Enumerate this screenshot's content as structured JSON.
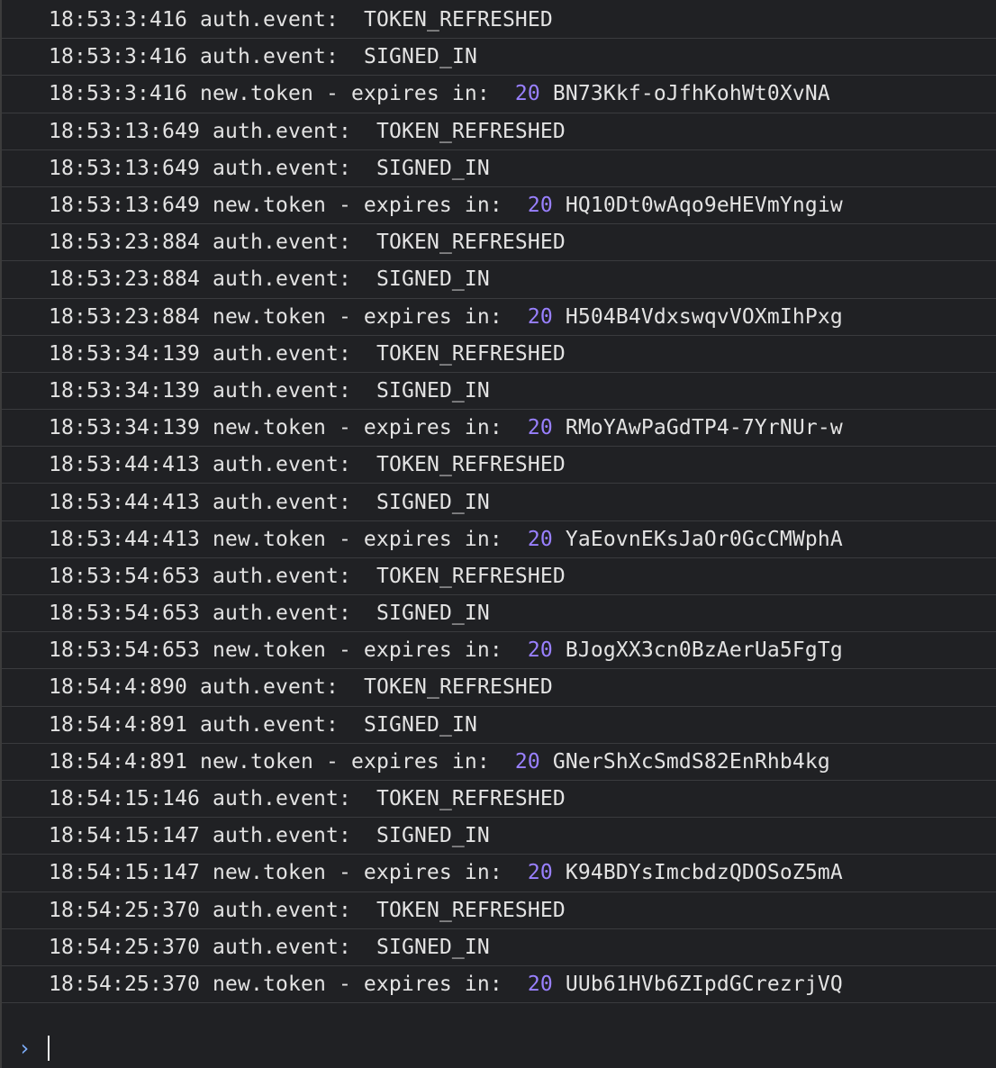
{
  "console": {
    "entries": [
      {
        "time": "18:53:3:416",
        "kind": "event",
        "label": "auth.event:",
        "value": "TOKEN_REFRESHED"
      },
      {
        "time": "18:53:3:416",
        "kind": "event",
        "label": "auth.event:",
        "value": "SIGNED_IN"
      },
      {
        "time": "18:53:3:416",
        "kind": "token",
        "label": "new.token - expires in:",
        "expires": "20",
        "value": "BN73Kkf-oJfhKohWt0XvNA"
      },
      {
        "time": "18:53:13:649",
        "kind": "event",
        "label": "auth.event:",
        "value": "TOKEN_REFRESHED"
      },
      {
        "time": "18:53:13:649",
        "kind": "event",
        "label": "auth.event:",
        "value": "SIGNED_IN"
      },
      {
        "time": "18:53:13:649",
        "kind": "token",
        "label": "new.token - expires in:",
        "expires": "20",
        "value": "HQ10Dt0wAqo9eHEVmYngiw"
      },
      {
        "time": "18:53:23:884",
        "kind": "event",
        "label": "auth.event:",
        "value": "TOKEN_REFRESHED"
      },
      {
        "time": "18:53:23:884",
        "kind": "event",
        "label": "auth.event:",
        "value": "SIGNED_IN"
      },
      {
        "time": "18:53:23:884",
        "kind": "token",
        "label": "new.token - expires in:",
        "expires": "20",
        "value": "H504B4VdxswqvVOXmIhPxg"
      },
      {
        "time": "18:53:34:139",
        "kind": "event",
        "label": "auth.event:",
        "value": "TOKEN_REFRESHED"
      },
      {
        "time": "18:53:34:139",
        "kind": "event",
        "label": "auth.event:",
        "value": "SIGNED_IN"
      },
      {
        "time": "18:53:34:139",
        "kind": "token",
        "label": "new.token - expires in:",
        "expires": "20",
        "value": "RMoYAwPaGdTP4-7YrNUr-w"
      },
      {
        "time": "18:53:44:413",
        "kind": "event",
        "label": "auth.event:",
        "value": "TOKEN_REFRESHED"
      },
      {
        "time": "18:53:44:413",
        "kind": "event",
        "label": "auth.event:",
        "value": "SIGNED_IN"
      },
      {
        "time": "18:53:44:413",
        "kind": "token",
        "label": "new.token - expires in:",
        "expires": "20",
        "value": "YaEovnEKsJaOr0GcCMWphA"
      },
      {
        "time": "18:53:54:653",
        "kind": "event",
        "label": "auth.event:",
        "value": "TOKEN_REFRESHED"
      },
      {
        "time": "18:53:54:653",
        "kind": "event",
        "label": "auth.event:",
        "value": "SIGNED_IN"
      },
      {
        "time": "18:53:54:653",
        "kind": "token",
        "label": "new.token - expires in:",
        "expires": "20",
        "value": "BJogXX3cn0BzAerUa5FgTg"
      },
      {
        "time": "18:54:4:890",
        "kind": "event",
        "label": "auth.event:",
        "value": "TOKEN_REFRESHED"
      },
      {
        "time": "18:54:4:891",
        "kind": "event",
        "label": "auth.event:",
        "value": "SIGNED_IN"
      },
      {
        "time": "18:54:4:891",
        "kind": "token",
        "label": "new.token - expires in:",
        "expires": "20",
        "value": "GNerShXcSmdS82EnRhb4kg"
      },
      {
        "time": "18:54:15:146",
        "kind": "event",
        "label": "auth.event:",
        "value": "TOKEN_REFRESHED"
      },
      {
        "time": "18:54:15:147",
        "kind": "event",
        "label": "auth.event:",
        "value": "SIGNED_IN"
      },
      {
        "time": "18:54:15:147",
        "kind": "token",
        "label": "new.token - expires in:",
        "expires": "20",
        "value": "K94BDYsImcbdzQDOSoZ5mA"
      },
      {
        "time": "18:54:25:370",
        "kind": "event",
        "label": "auth.event:",
        "value": "TOKEN_REFRESHED"
      },
      {
        "time": "18:54:25:370",
        "kind": "event",
        "label": "auth.event:",
        "value": "SIGNED_IN"
      },
      {
        "time": "18:54:25:370",
        "kind": "token",
        "label": "new.token - expires in:",
        "expires": "20",
        "value": "UUb61HVb6ZIpdGCrezrjVQ"
      }
    ],
    "prompt": {
      "icon": "chevron-right-icon",
      "value": ""
    },
    "colors": {
      "background": "#202124",
      "text": "#e3e3e3",
      "number": "#9980ff",
      "prompt": "#7cacf8",
      "divider": "#3a3b3e"
    }
  }
}
